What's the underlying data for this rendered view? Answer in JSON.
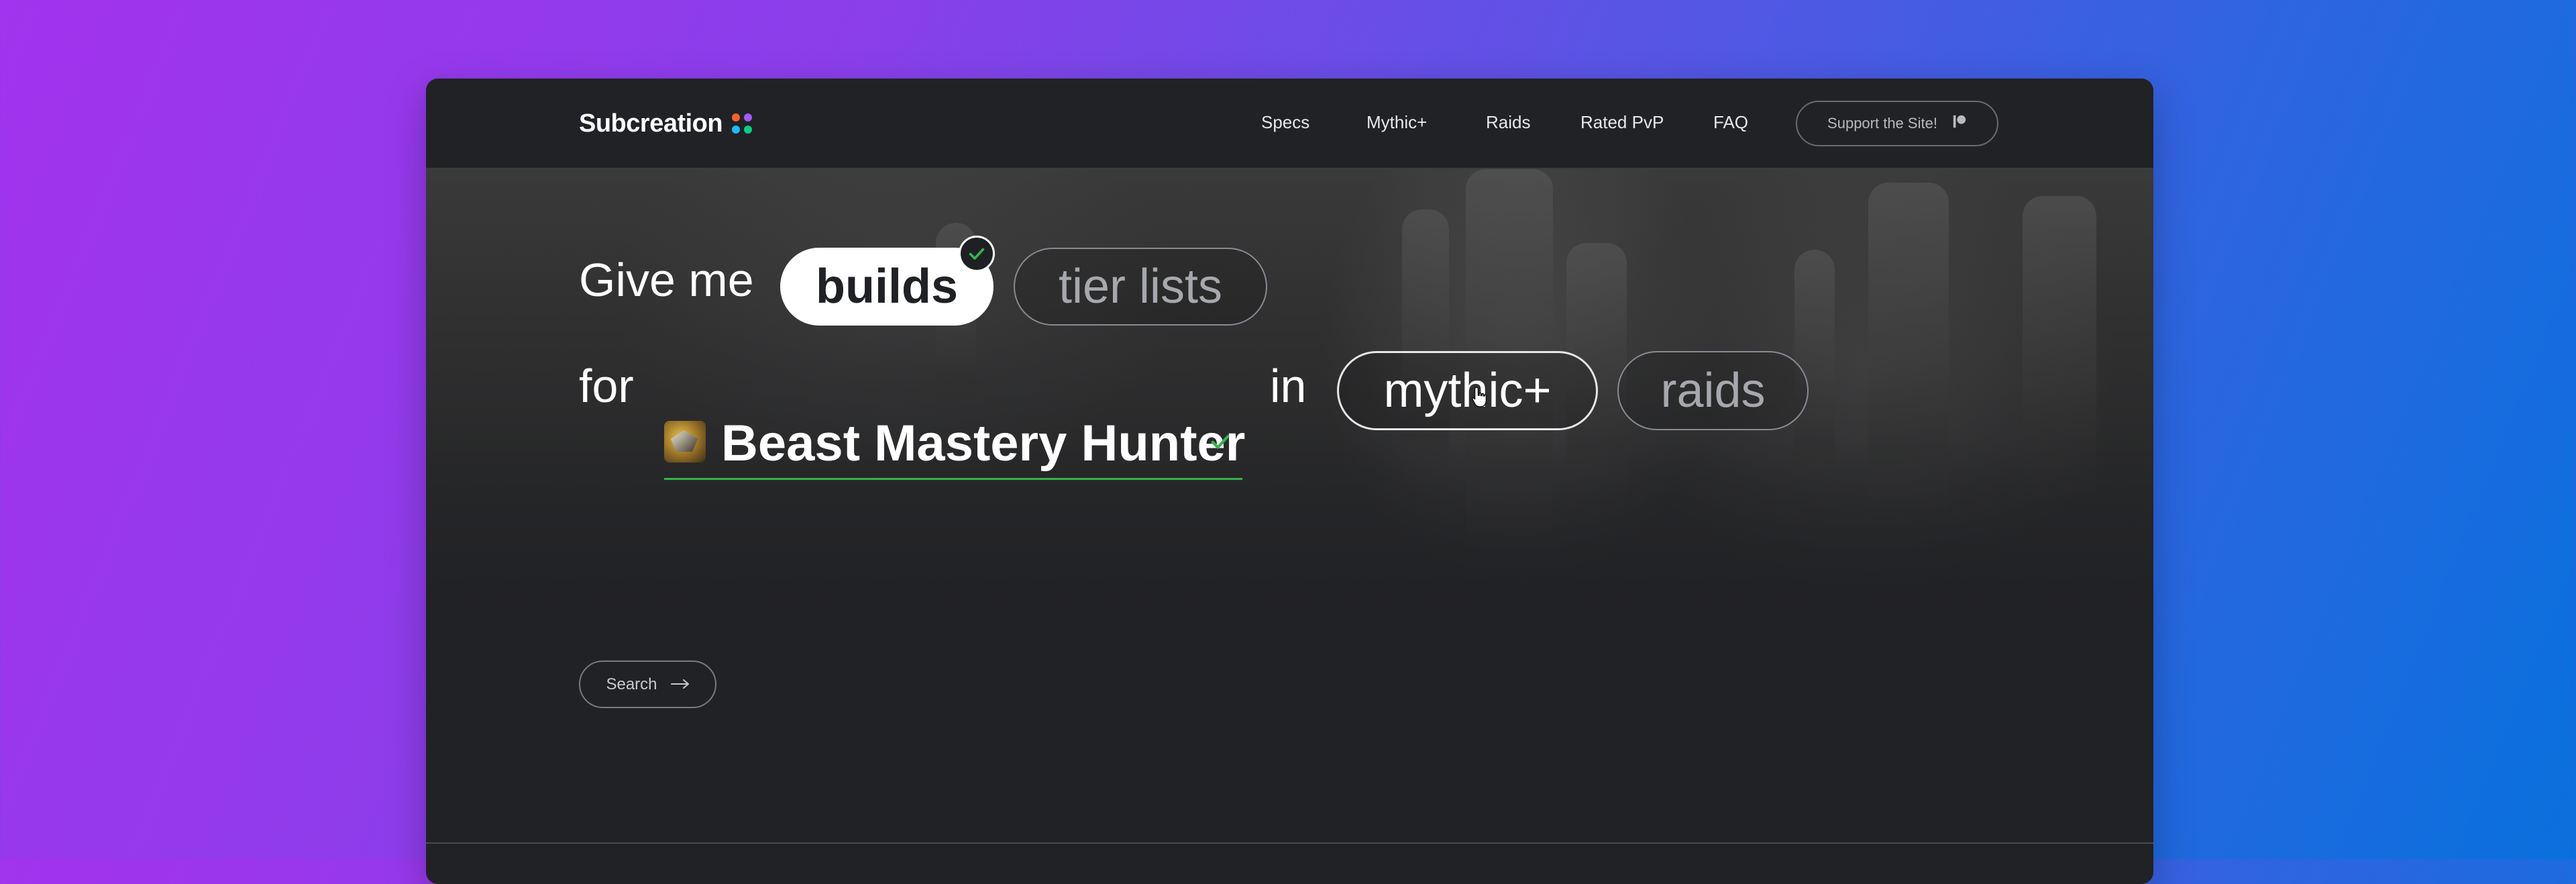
{
  "brand": {
    "name": "Subcreation",
    "dot_colors": [
      "#f2622e",
      "#a259ff",
      "#1abcfe",
      "#0acf83"
    ]
  },
  "nav": {
    "links": [
      "Specs",
      "Mythic+",
      "Raids",
      "Rated PvP",
      "FAQ"
    ],
    "support_label": "Support the Site!"
  },
  "hero": {
    "give_me": "Give me",
    "content_options": [
      {
        "label": "builds",
        "selected": true
      },
      {
        "label": "tier lists",
        "selected": false
      }
    ],
    "for": "for",
    "spec": {
      "name": "Beast Mastery Hunter",
      "icon": "beast-mastery-hunter-icon",
      "confirmed": true
    },
    "in": "in",
    "mode_options": [
      {
        "label": "mythic+",
        "hovered": true
      },
      {
        "label": "raids",
        "hovered": false
      }
    ]
  },
  "search": {
    "label": "Search"
  },
  "footer": {
    "social_icons": [
      "discord-icon",
      "github-icon",
      "twitter-icon",
      "patreon-icon"
    ]
  },
  "colors": {
    "accent_green": "#37b24d",
    "panel_bg": "#212225",
    "background_gradient": [
      "#a233ee",
      "#0870dc"
    ]
  }
}
